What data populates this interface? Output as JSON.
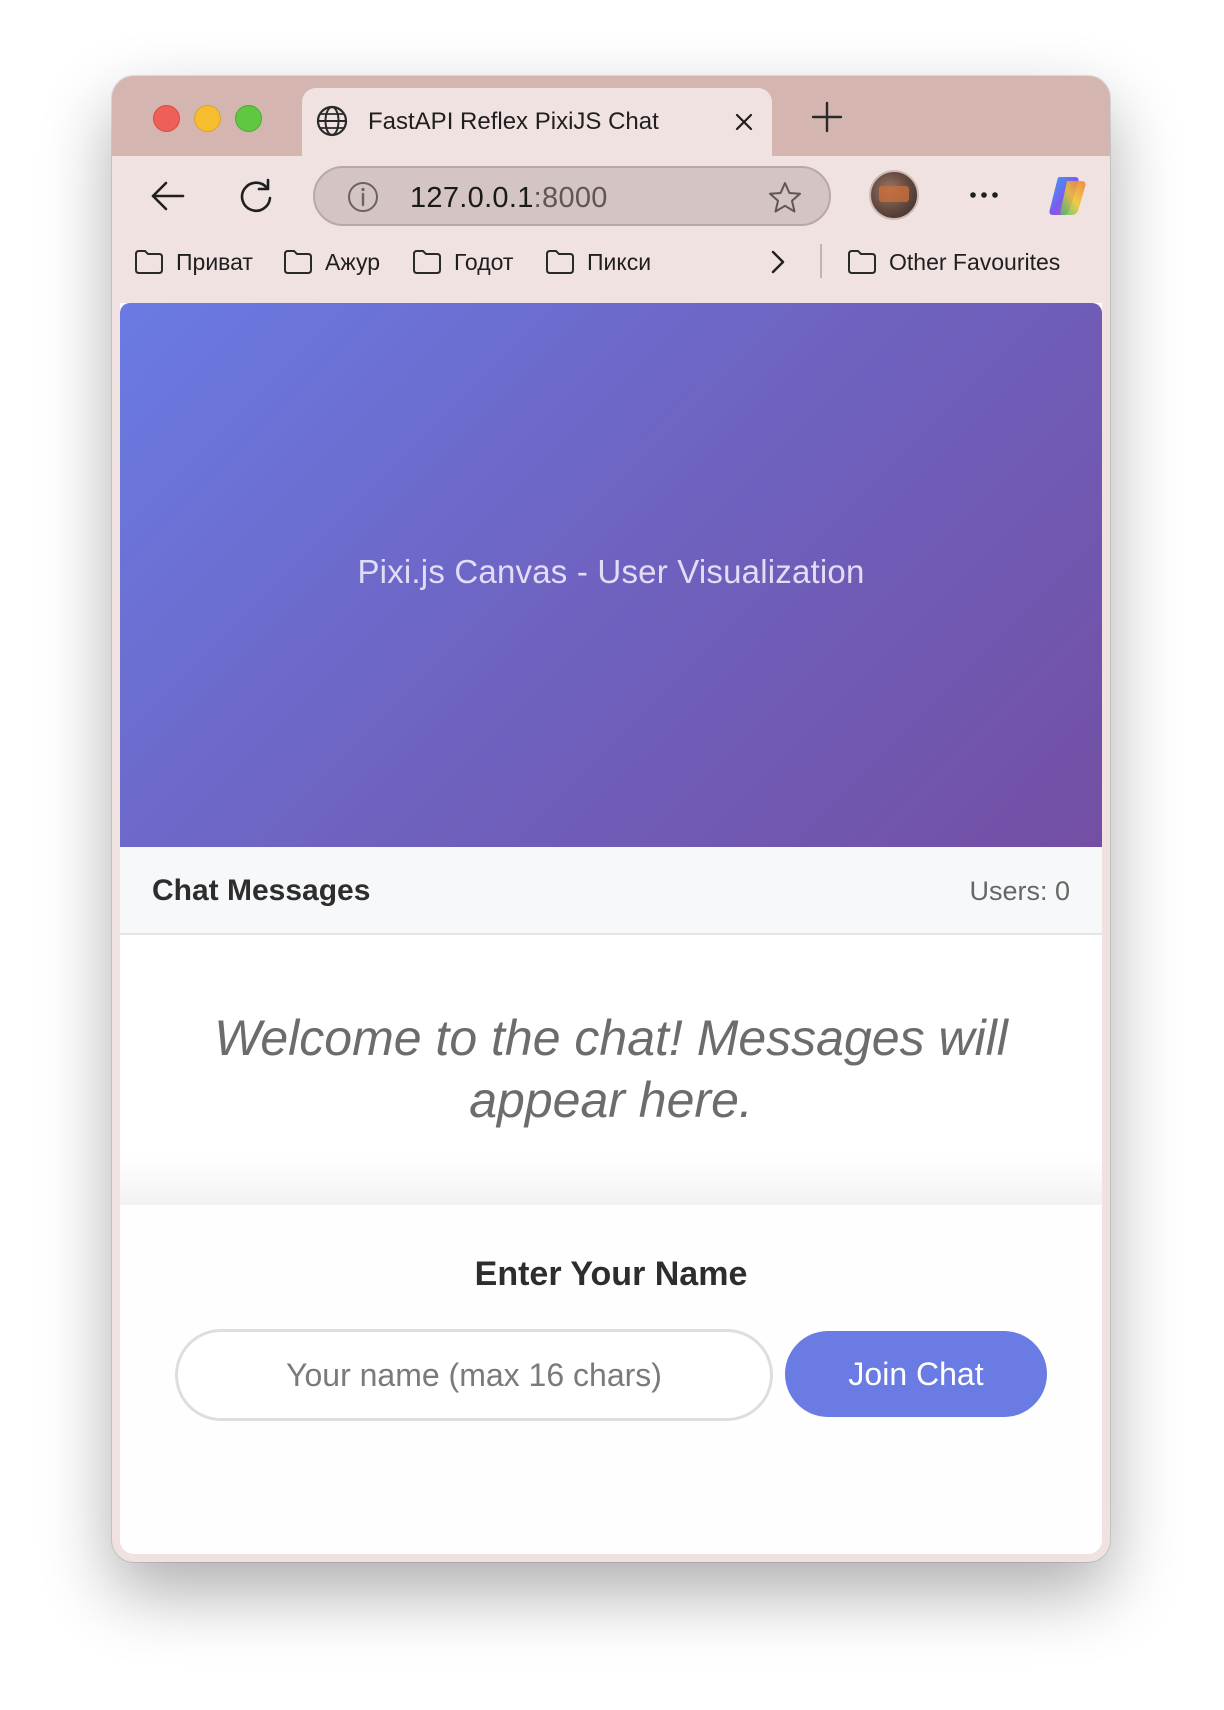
{
  "browser": {
    "tab": {
      "title": "FastAPI Reflex PixiJS Chat",
      "icon": "globe-icon"
    },
    "address": {
      "host": "127.0.0.1",
      "port": ":8000"
    },
    "bookmarks": [
      {
        "label": "Приват",
        "icon": "folder-icon"
      },
      {
        "label": "Ажур",
        "icon": "folder-icon"
      },
      {
        "label": "Годот",
        "icon": "folder-icon"
      },
      {
        "label": "Пикси",
        "icon": "folder-icon"
      }
    ],
    "other_favourites": "Other Favourites"
  },
  "canvas": {
    "label": "Pixi.js Canvas - User Visualization",
    "gradient_start": "#6a7be3",
    "gradient_end": "#734fa3"
  },
  "chat": {
    "title": "Chat Messages",
    "users_label": "Users: 0",
    "welcome": "Welcome to the chat! Messages will appear here."
  },
  "join": {
    "title": "Enter Your Name",
    "input_placeholder": "Your name (max 16 chars)",
    "input_value": "",
    "button_label": "Join Chat",
    "accent": "#6a7be3"
  }
}
